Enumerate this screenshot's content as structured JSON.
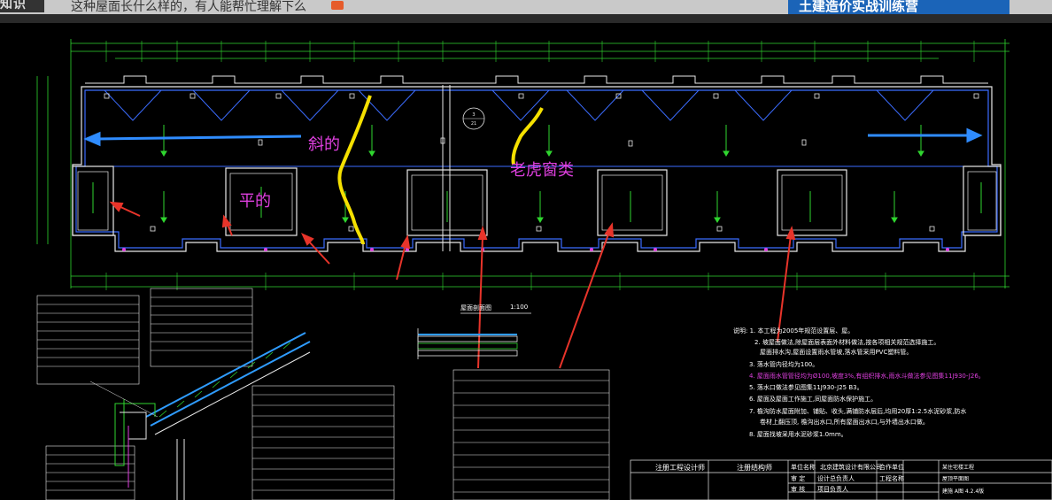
{
  "page_header": {
    "question_title": "这种屋面长什么样的，有人能帮忙理解下么",
    "banner_text": "土建造价实战训练营"
  },
  "annotations": {
    "sloped": "斜的",
    "flat": "平的",
    "dormer": "老虎窗类"
  },
  "drawing": {
    "section_title": "屋面剖面图",
    "section_scale": "1:100",
    "index_symbol_top": "3",
    "index_symbol_bottom": "21"
  },
  "notes": {
    "intro": "说明: 1. 本工程为2005年规范设置层、屋。",
    "items": [
      "2. 坡屋面做法,除屋面层表面外材料做法,按各项相关规范选择施工。",
      "屋面排水沟,屋面设置雨水管坡,落水管采用PVC塑料管。",
      "3. 落水管内径均为100。",
      "4. 屋面雨水管管径均为Ø100,坡度3%,有组织排水,雨水斗做法参见图集11J930-J26。",
      "5. 落水口做法参见图集11J930-J25 B3。",
      "6. 屋面及屋面工作施工,同屋面防水保护施工。",
      "7. 檐沟防水屋面附加、铺贴、收头,满铺防水层后,均用20厚1:2.5水泥砂浆,防水",
      "卷材上翻压顶,   檐沟出水口,所有屋面出水口,与外墙出水口做。",
      "8. 屋面找坡采用水泥砂浆1.0mm。"
    ]
  },
  "title_block": {
    "col1": "注册工程设计师",
    "col2": "注册结构师",
    "unit_label": "单位名称",
    "unit_name": "北京建筑设计有限公司",
    "collab": "合作单位",
    "project": "工程名称",
    "project_value": "某住宅楼工程",
    "owner_label": "设计总负责人",
    "review": "审 定",
    "approve": "审 核",
    "project_lead": "项目负责人",
    "drawing_name": "屋顶平面图",
    "sheet": "建施 A图 4.2.4版"
  }
}
